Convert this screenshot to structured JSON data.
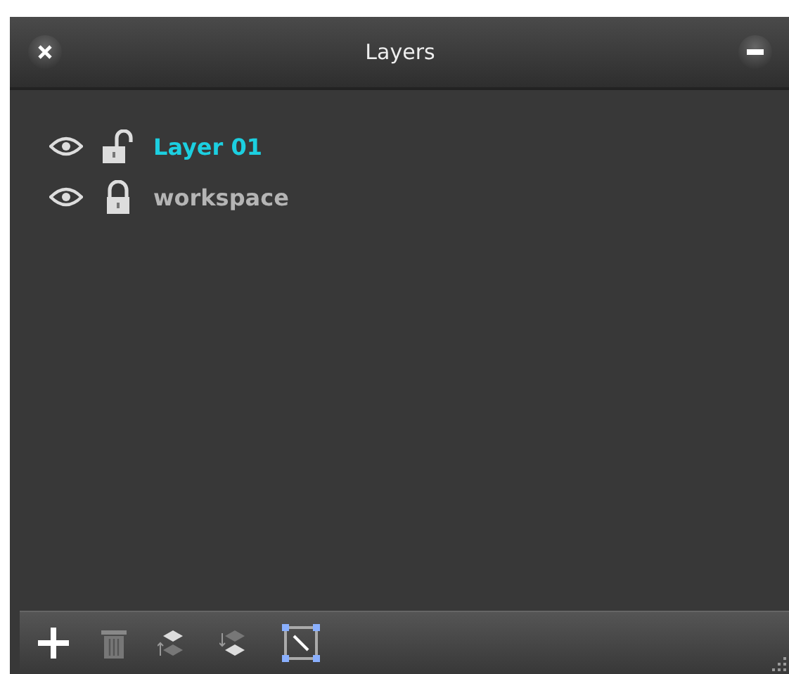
{
  "window": {
    "title": "Layers"
  },
  "layers": [
    {
      "name": "Layer 01",
      "visible": true,
      "locked": false,
      "selected": true
    },
    {
      "name": "workspace",
      "visible": true,
      "locked": true,
      "selected": false
    }
  ]
}
